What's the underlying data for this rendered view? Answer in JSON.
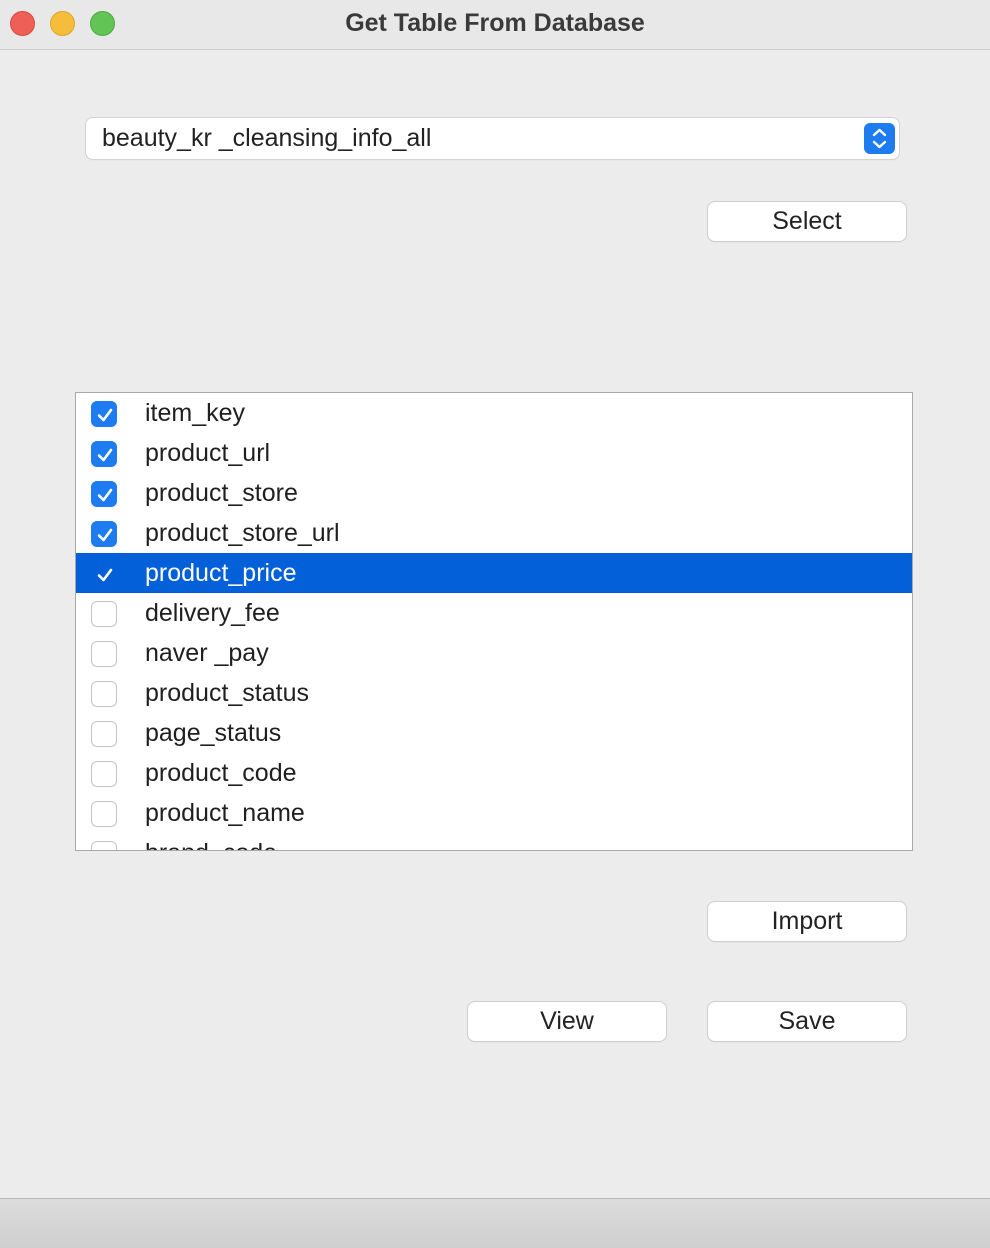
{
  "window": {
    "title": "Get Table From Database"
  },
  "table_select": {
    "value": "beauty_kr _cleansing_info_all"
  },
  "buttons": {
    "select_label": "Select",
    "import_label": "Import",
    "view_label": "View",
    "save_label": "Save"
  },
  "columns": [
    {
      "label": "item_key",
      "checked": true,
      "selected": false
    },
    {
      "label": "product_url",
      "checked": true,
      "selected": false
    },
    {
      "label": "product_store",
      "checked": true,
      "selected": false
    },
    {
      "label": "product_store_url",
      "checked": true,
      "selected": false
    },
    {
      "label": "product_price",
      "checked": true,
      "selected": true
    },
    {
      "label": "delivery_fee",
      "checked": false,
      "selected": false
    },
    {
      "label": "naver _pay",
      "checked": false,
      "selected": false
    },
    {
      "label": "product_status",
      "checked": false,
      "selected": false
    },
    {
      "label": "page_status",
      "checked": false,
      "selected": false
    },
    {
      "label": "product_code",
      "checked": false,
      "selected": false
    },
    {
      "label": "product_name",
      "checked": false,
      "selected": false
    },
    {
      "label": "brand_code",
      "checked": false,
      "selected": false
    }
  ],
  "colors": {
    "accent": "#1e7bf0",
    "selection": "#0460d9",
    "background": "#ececec"
  }
}
